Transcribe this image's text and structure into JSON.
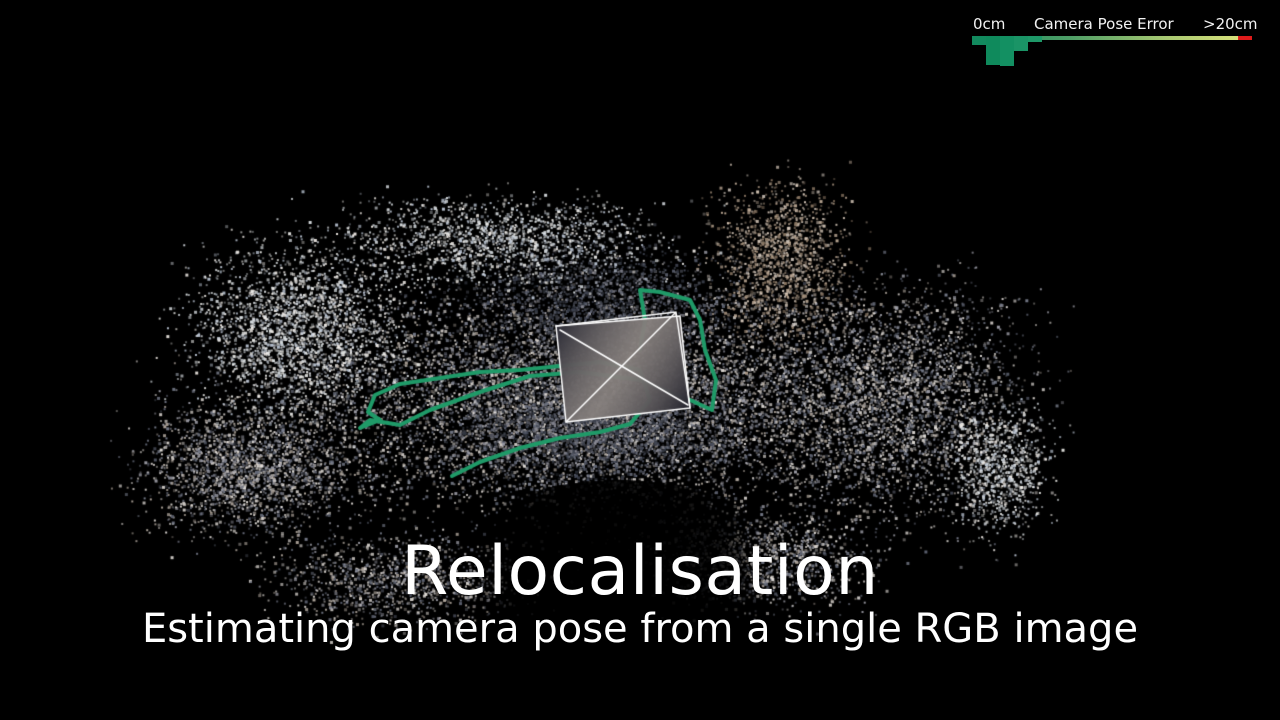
{
  "legend": {
    "min_label": "0cm",
    "title": "Camera Pose Error",
    "max_label": ">20cm",
    "gradient_colors": [
      "#128a5e",
      "#5fa96a",
      "#c9d977",
      "#e01b1b"
    ]
  },
  "caption": {
    "title": "Relocalisation",
    "subtitle": "Estimating camera pose from a single RGB image"
  },
  "scene": {
    "description_icon": "point-cloud-reconstruction",
    "trajectory_color": "#1f9a68",
    "camera_frustum_color": "#ffffff"
  }
}
